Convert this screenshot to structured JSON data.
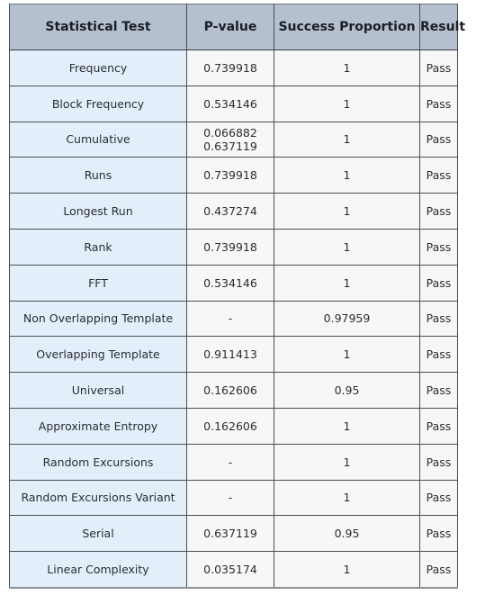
{
  "table": {
    "headers": {
      "test": "Statistical Test",
      "pvalue": "P-value",
      "proportion": "Success Proportion",
      "result": "Result"
    },
    "rows": [
      {
        "test": "Frequency",
        "pvalue": [
          "0.739918"
        ],
        "proportion": "1",
        "result": "Pass"
      },
      {
        "test": "Block Frequency",
        "pvalue": [
          "0.534146"
        ],
        "proportion": "1",
        "result": "Pass"
      },
      {
        "test": "Cumulative",
        "pvalue": [
          "0.066882",
          "0.637119"
        ],
        "proportion": "1",
        "result": "Pass"
      },
      {
        "test": "Runs",
        "pvalue": [
          "0.739918"
        ],
        "proportion": "1",
        "result": "Pass"
      },
      {
        "test": "Longest Run",
        "pvalue": [
          "0.437274"
        ],
        "proportion": "1",
        "result": "Pass"
      },
      {
        "test": "Rank",
        "pvalue": [
          "0.739918"
        ],
        "proportion": "1",
        "result": "Pass"
      },
      {
        "test": "FFT",
        "pvalue": [
          "0.534146"
        ],
        "proportion": "1",
        "result": "Pass"
      },
      {
        "test": "Non Overlapping Template",
        "pvalue": [
          "-"
        ],
        "proportion": "0.97959",
        "result": "Pass"
      },
      {
        "test": "Overlapping Template",
        "pvalue": [
          "0.911413"
        ],
        "proportion": "1",
        "result": "Pass"
      },
      {
        "test": "Universal",
        "pvalue": [
          "0.162606"
        ],
        "proportion": "0.95",
        "result": "Pass"
      },
      {
        "test": "Approximate Entropy",
        "pvalue": [
          "0.162606"
        ],
        "proportion": "1",
        "result": "Pass"
      },
      {
        "test": "Random Excursions",
        "pvalue": [
          "-"
        ],
        "proportion": "1",
        "result": "Pass"
      },
      {
        "test": "Random Excursions Variant",
        "pvalue": [
          "-"
        ],
        "proportion": "1",
        "result": "Pass"
      },
      {
        "test": "Serial",
        "pvalue": [
          "0.637119"
        ],
        "proportion": "0.95",
        "result": "Pass"
      },
      {
        "test": "Linear Complexity",
        "pvalue": [
          "0.035174"
        ],
        "proportion": "1",
        "result": "Pass"
      }
    ]
  },
  "colors": {
    "header_bg": "#b4bfd0",
    "test_col_bg": "#e2effa",
    "cell_bg": "#f7f7f7",
    "border": "#4a4f55"
  }
}
